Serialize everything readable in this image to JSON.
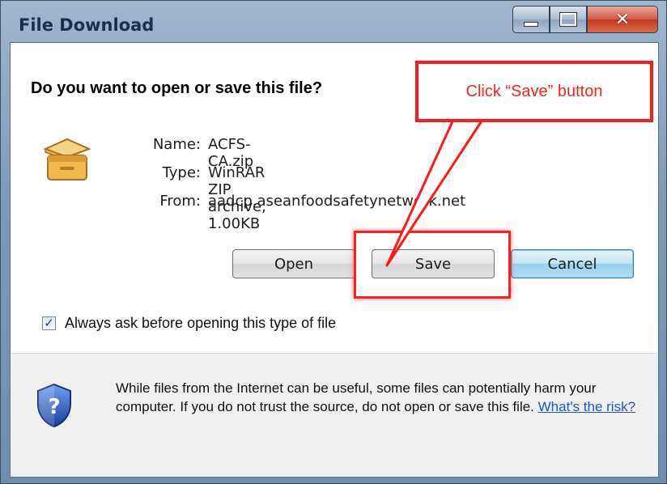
{
  "window": {
    "title": "File Download",
    "controls": {
      "minimize": "minimize-icon",
      "maximize": "maximize-icon",
      "close": "close-icon"
    }
  },
  "dialog": {
    "question": "Do you want to open or save this file?",
    "file_icon": "package-box-icon",
    "fields": {
      "name_label": "Name:",
      "name_value": "ACFS-CA.zip",
      "type_label": "Type:",
      "type_value": "WinRAR ZIP archive, 1.00KB",
      "from_label": "From:",
      "from_value": "aadcp.aseanfoodsafetynetwork.net"
    },
    "buttons": {
      "open": "Open",
      "save": "Save",
      "cancel": "Cancel"
    },
    "checkbox": {
      "label": "Always ask before opening this type of file",
      "checked": true
    }
  },
  "footer": {
    "icon": "security-shield-question-icon",
    "warning": "While files from the Internet can be useful, some files can potentially harm your computer. If you do not trust the source, do not open or save this file.",
    "risk_link": "What's the risk?"
  },
  "annotation": {
    "callout_text": "Click “Save” button",
    "color": "#ff1a1a"
  }
}
